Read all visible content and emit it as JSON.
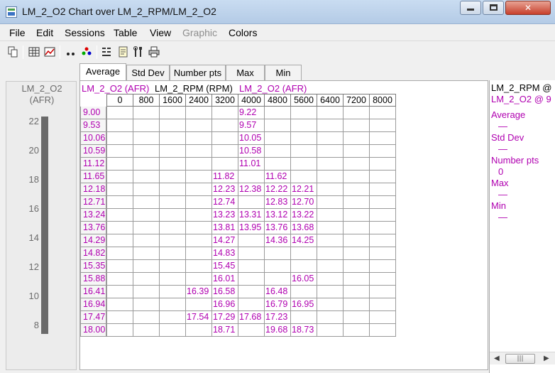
{
  "window": {
    "title": "LM_2_O2 Chart over LM_2_RPM/LM_2_O2"
  },
  "menu": [
    "File",
    "Edit",
    "Sessions",
    "Table",
    "View",
    "Graphic",
    "Colors"
  ],
  "toolbar": [
    "copy-icon",
    "table-icon",
    "chart-icon",
    "dots-icon",
    "color-dots-icon",
    "scatter-icon",
    "notes-icon",
    "tools-icon",
    "print-icon"
  ],
  "gauge": {
    "name": "LM_2_O2",
    "unit": "(AFR)",
    "ticks": [
      "22",
      "20",
      "18",
      "16",
      "14",
      "12",
      "10",
      "8"
    ]
  },
  "tabs": [
    "Average",
    "Std Dev",
    "Number pts",
    "Max",
    "Min"
  ],
  "grid": {
    "header_y": "LM_2_O2 (AFR)",
    "header_x": "LM_2_RPM (RPM)",
    "header_z": "LM_2_O2 (AFR)",
    "columns": [
      "0",
      "800",
      "1600",
      "2400",
      "3200",
      "4000",
      "4800",
      "5600",
      "6400",
      "7200",
      "8000"
    ],
    "rows": [
      {
        "label": "9.00",
        "cells": [
          "",
          "",
          "",
          "",
          "",
          "9.22",
          "",
          "",
          "",
          "",
          ""
        ]
      },
      {
        "label": "9.53",
        "cells": [
          "",
          "",
          "",
          "",
          "",
          "9.57",
          "",
          "",
          "",
          "",
          ""
        ]
      },
      {
        "label": "10.06",
        "cells": [
          "",
          "",
          "",
          "",
          "",
          "10.05",
          "",
          "",
          "",
          "",
          ""
        ]
      },
      {
        "label": "10.59",
        "cells": [
          "",
          "",
          "",
          "",
          "",
          "10.58",
          "",
          "",
          "",
          "",
          ""
        ]
      },
      {
        "label": "11.12",
        "cells": [
          "",
          "",
          "",
          "",
          "",
          "11.01",
          "",
          "",
          "",
          "",
          ""
        ]
      },
      {
        "label": "11.65",
        "cells": [
          "",
          "",
          "",
          "",
          "11.82",
          "",
          "11.62",
          "",
          "",
          "",
          ""
        ]
      },
      {
        "label": "12.18",
        "cells": [
          "",
          "",
          "",
          "",
          "12.23",
          "12.38",
          "12.22",
          "12.21",
          "",
          "",
          ""
        ]
      },
      {
        "label": "12.71",
        "cells": [
          "",
          "",
          "",
          "",
          "12.74",
          "",
          "12.83",
          "12.70",
          "",
          "",
          ""
        ]
      },
      {
        "label": "13.24",
        "cells": [
          "",
          "",
          "",
          "",
          "13.23",
          "13.31",
          "13.12",
          "13.22",
          "",
          "",
          ""
        ]
      },
      {
        "label": "13.76",
        "cells": [
          "",
          "",
          "",
          "",
          "13.81",
          "13.95",
          "13.76",
          "13.68",
          "",
          "",
          ""
        ]
      },
      {
        "label": "14.29",
        "cells": [
          "",
          "",
          "",
          "",
          "14.27",
          "",
          "14.36",
          "14.25",
          "",
          "",
          ""
        ]
      },
      {
        "label": "14.82",
        "cells": [
          "",
          "",
          "",
          "",
          "14.83",
          "",
          "",
          "",
          "",
          "",
          ""
        ]
      },
      {
        "label": "15.35",
        "cells": [
          "",
          "",
          "",
          "",
          "15.45",
          "",
          "",
          "",
          "",
          "",
          ""
        ]
      },
      {
        "label": "15.88",
        "cells": [
          "",
          "",
          "",
          "",
          "16.01",
          "",
          "",
          "16.05",
          "",
          "",
          ""
        ]
      },
      {
        "label": "16.41",
        "cells": [
          "",
          "",
          "",
          "16.39",
          "16.58",
          "",
          "16.48",
          "",
          "",
          "",
          ""
        ]
      },
      {
        "label": "16.94",
        "cells": [
          "",
          "",
          "",
          "",
          "16.96",
          "",
          "16.79",
          "16.95",
          "",
          "",
          ""
        ]
      },
      {
        "label": "17.47",
        "cells": [
          "",
          "",
          "",
          "17.54",
          "17.29",
          "17.68",
          "17.23",
          "",
          "",
          "",
          ""
        ]
      },
      {
        "label": "18.00",
        "cells": [
          "",
          "",
          "",
          "",
          "18.71",
          "",
          "19.68",
          "18.73",
          "",
          "",
          ""
        ]
      }
    ]
  },
  "stats_panel": {
    "line1": "LM_2_RPM @",
    "line2": "LM_2_O2 @ 9",
    "items": [
      {
        "label": "Average",
        "value": "—"
      },
      {
        "label": "Std Dev",
        "value": "—"
      },
      {
        "label": "Number pts",
        "value": "0"
      },
      {
        "label": "Max",
        "value": "—"
      },
      {
        "label": "Min",
        "value": "—"
      }
    ]
  },
  "colors": {
    "value_magenta": "#b000b0",
    "title_bar": "#c9dcf1",
    "gauge_bar": "#6a6a6a"
  }
}
